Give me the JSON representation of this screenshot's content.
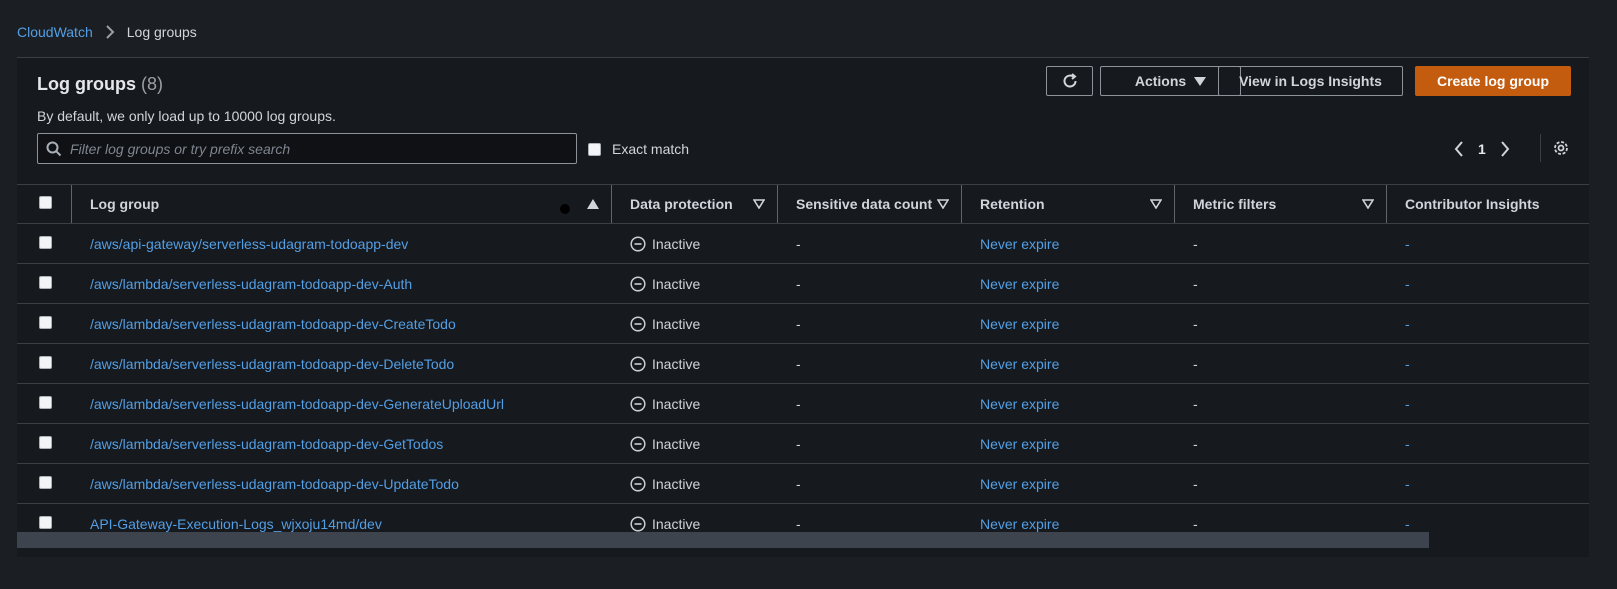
{
  "breadcrumb": {
    "root": "CloudWatch",
    "current": "Log groups"
  },
  "header": {
    "title": "Log groups",
    "count": "(8)",
    "subtitle": "By default, we only load up to 10000 log groups.",
    "actions_label": "Actions",
    "insights_label": "View in Logs Insights",
    "create_label": "Create log group"
  },
  "search": {
    "placeholder": "Filter log groups or try prefix search",
    "exact_match_label": "Exact match"
  },
  "pagination": {
    "page": "1"
  },
  "table": {
    "columns": {
      "log_group": "Log group",
      "data_protection": "Data protection",
      "sensitive": "Sensitive data count",
      "retention": "Retention",
      "metric_filters": "Metric filters",
      "contributor": "Contributor Insights"
    },
    "rows": [
      {
        "name": "/aws/api-gateway/serverless-udagram-todoapp-dev",
        "protection": "Inactive",
        "sensitive": "-",
        "retention": "Never expire",
        "metric": "-",
        "contributor": "-"
      },
      {
        "name": "/aws/lambda/serverless-udagram-todoapp-dev-Auth",
        "protection": "Inactive",
        "sensitive": "-",
        "retention": "Never expire",
        "metric": "-",
        "contributor": "-"
      },
      {
        "name": "/aws/lambda/serverless-udagram-todoapp-dev-CreateTodo",
        "protection": "Inactive",
        "sensitive": "-",
        "retention": "Never expire",
        "metric": "-",
        "contributor": "-"
      },
      {
        "name": "/aws/lambda/serverless-udagram-todoapp-dev-DeleteTodo",
        "protection": "Inactive",
        "sensitive": "-",
        "retention": "Never expire",
        "metric": "-",
        "contributor": "-"
      },
      {
        "name": "/aws/lambda/serverless-udagram-todoapp-dev-GenerateUploadUrl",
        "protection": "Inactive",
        "sensitive": "-",
        "retention": "Never expire",
        "metric": "-",
        "contributor": "-"
      },
      {
        "name": "/aws/lambda/serverless-udagram-todoapp-dev-GetTodos",
        "protection": "Inactive",
        "sensitive": "-",
        "retention": "Never expire",
        "metric": "-",
        "contributor": "-"
      },
      {
        "name": "/aws/lambda/serverless-udagram-todoapp-dev-UpdateTodo",
        "protection": "Inactive",
        "sensitive": "-",
        "retention": "Never expire",
        "metric": "-",
        "contributor": "-"
      },
      {
        "name": "API-Gateway-Execution-Logs_wjxoju14md/dev",
        "protection": "Inactive",
        "sensitive": "-",
        "retention": "Never expire",
        "metric": "-",
        "contributor": "-"
      }
    ]
  },
  "colors": {
    "link": "#539fe5",
    "primary_button": "#c45c0f",
    "background": "#1b1f24",
    "panel": "#16191e"
  },
  "icons": {
    "refresh": "refresh-icon",
    "actions_caret": "caret-down-icon",
    "search": "search-icon",
    "pager_prev": "chevron-left-icon",
    "pager_next": "chevron-right-icon",
    "settings": "gear-icon",
    "sort_asc": "sort-ascending-icon",
    "sort": "sort-icon",
    "status_inactive": "inactive-status-icon"
  }
}
